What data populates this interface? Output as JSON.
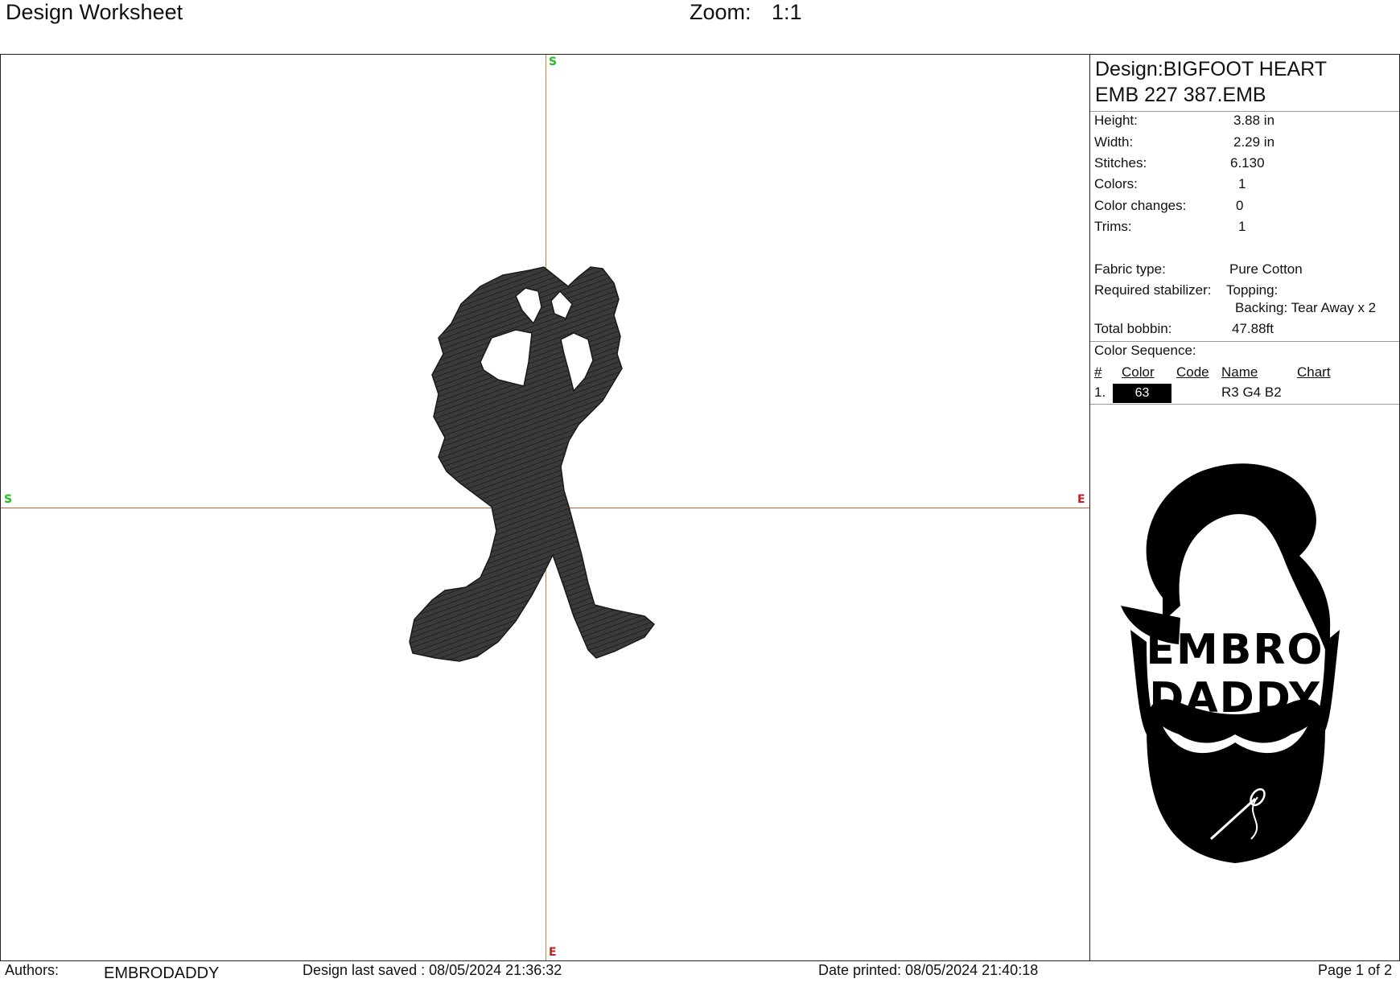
{
  "header": {
    "title": "Design Worksheet",
    "zoom_label": "Zoom:",
    "zoom_value": "1:1"
  },
  "canvas": {
    "markers": {
      "top": "S",
      "left": "S",
      "right": "E",
      "bottom": "E"
    }
  },
  "info": {
    "design_line1": "Design:BIGFOOT HEART",
    "design_line2": "EMB 227 387.EMB",
    "specs": [
      {
        "label": "Height:",
        "value": "3.88 in"
      },
      {
        "label": "Width:",
        "value": "2.29 in"
      },
      {
        "label": "Stitches:",
        "value": "6.130"
      },
      {
        "label": "Colors:",
        "value": "1"
      },
      {
        "label": "Color changes:",
        "value": "0"
      },
      {
        "label": "Trims:",
        "value": "1"
      }
    ],
    "fabric_label": "Fabric type:",
    "fabric_value": "Pure Cotton",
    "stabilizer_label": "Required stabilizer:",
    "topping": "Topping:",
    "backing": "Backing: Tear Away x 2",
    "bobbin_label": "Total bobbin:",
    "bobbin_value": "47.88ft",
    "color_sequence_title": "Color Sequence:",
    "columns": [
      "#",
      "Color",
      "Code",
      "Name",
      "Chart"
    ],
    "colors": [
      {
        "index": "1.",
        "color": "63",
        "code": "",
        "name": "R3 G4 B2",
        "chart": "",
        "swatch": "#000000"
      }
    ]
  },
  "logo": {
    "line1": "EMBRO",
    "line2": "DADDY"
  },
  "footer": {
    "authors_label": "Authors:",
    "authors_value": "EMBRODADDY",
    "saved": "Design last saved : 08/05/2024 21:36:32",
    "printed": "Date printed: 08/05/2024 21:40:18",
    "page": "Page 1 of 2"
  }
}
